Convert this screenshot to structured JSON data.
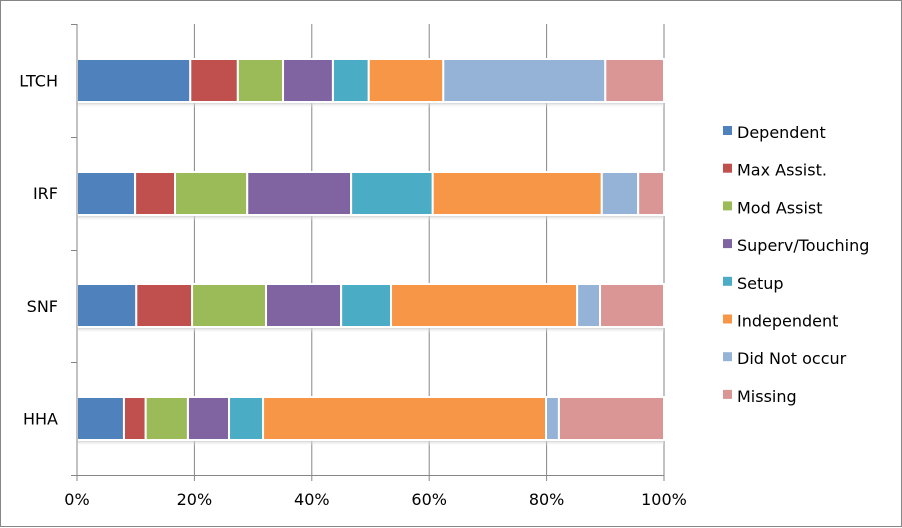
{
  "chart_data": {
    "type": "bar",
    "orientation": "horizontal",
    "stacked": "percent",
    "title": "",
    "xlabel": "",
    "ylabel": "",
    "xlim": [
      0,
      100
    ],
    "x_ticks": [
      "0%",
      "20%",
      "40%",
      "60%",
      "80%",
      "100%"
    ],
    "x_tick_values": [
      0,
      20,
      40,
      60,
      80,
      100
    ],
    "grid": "vertical major gridlines",
    "legend_position": "right",
    "categories": [
      "LTCH",
      "IRF",
      "SNF",
      "HHA"
    ],
    "series": [
      {
        "name": "Dependent",
        "color": "#4F81BD",
        "values": [
          19.3,
          9.9,
          10.1,
          8.0
        ]
      },
      {
        "name": "Max Assist.",
        "color": "#C0504D",
        "values": [
          8.1,
          6.8,
          9.5,
          3.7
        ]
      },
      {
        "name": "Mod Assist",
        "color": "#9BBB59",
        "values": [
          7.7,
          12.3,
          12.6,
          7.2
        ]
      },
      {
        "name": "Superv/Touching",
        "color": "#8064A2",
        "values": [
          8.5,
          17.7,
          12.8,
          7.0
        ]
      },
      {
        "name": "Setup",
        "color": "#4BACC6",
        "values": [
          6.1,
          13.9,
          8.5,
          5.8
        ]
      },
      {
        "name": "Independent",
        "color": "#F79646",
        "values": [
          12.7,
          28.8,
          31.7,
          48.2
        ]
      },
      {
        "name": "Did Not occur",
        "color": "#95B3D7",
        "values": [
          27.6,
          6.2,
          3.9,
          2.2
        ]
      },
      {
        "name": "Missing",
        "color": "#D99694",
        "values": [
          10.0,
          4.4,
          10.9,
          17.9
        ]
      }
    ]
  }
}
